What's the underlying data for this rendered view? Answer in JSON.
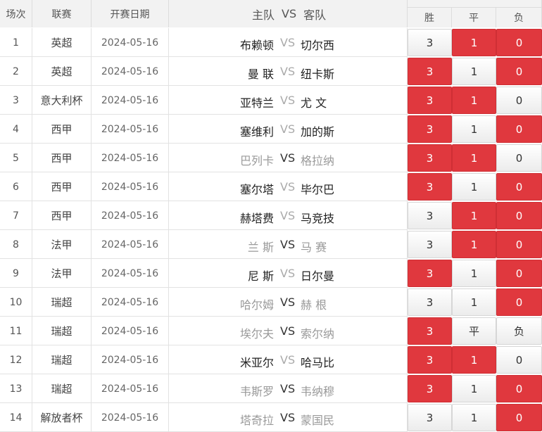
{
  "headers": {
    "index": "场次",
    "league": "联赛",
    "date": "开赛日期",
    "home": "主队",
    "vs": "VS",
    "away": "客队",
    "win": "胜",
    "draw": "平",
    "lose": "负"
  },
  "colors": {
    "selected": "#e0383e",
    "unselected": "#f3f3f3"
  },
  "matches": [
    {
      "no": "1",
      "league": "英超",
      "date": "2024-05-16",
      "home": "布赖顿",
      "away": "切尔西",
      "home_dim": false,
      "away_dim": false,
      "win": "3",
      "draw": "1",
      "lose": "0",
      "sel": [
        false,
        true,
        true
      ]
    },
    {
      "no": "2",
      "league": "英超",
      "date": "2024-05-16",
      "home": "曼 联",
      "away": "纽卡斯",
      "home_dim": false,
      "away_dim": false,
      "win": "3",
      "draw": "1",
      "lose": "0",
      "sel": [
        true,
        false,
        true
      ]
    },
    {
      "no": "3",
      "league": "意大利杯",
      "date": "2024-05-16",
      "home": "亚特兰",
      "away": "尤 文",
      "home_dim": false,
      "away_dim": false,
      "win": "3",
      "draw": "1",
      "lose": "0",
      "sel": [
        true,
        true,
        false
      ]
    },
    {
      "no": "4",
      "league": "西甲",
      "date": "2024-05-16",
      "home": "塞维利",
      "away": "加的斯",
      "home_dim": false,
      "away_dim": false,
      "win": "3",
      "draw": "1",
      "lose": "0",
      "sel": [
        true,
        false,
        true
      ]
    },
    {
      "no": "5",
      "league": "西甲",
      "date": "2024-05-16",
      "home": "巴列卡",
      "away": "格拉纳",
      "home_dim": true,
      "away_dim": true,
      "win": "3",
      "draw": "1",
      "lose": "0",
      "sel": [
        true,
        true,
        false
      ]
    },
    {
      "no": "6",
      "league": "西甲",
      "date": "2024-05-16",
      "home": "塞尔塔",
      "away": "毕尔巴",
      "home_dim": false,
      "away_dim": false,
      "win": "3",
      "draw": "1",
      "lose": "0",
      "sel": [
        true,
        false,
        true
      ]
    },
    {
      "no": "7",
      "league": "西甲",
      "date": "2024-05-16",
      "home": "赫塔费",
      "away": "马竞技",
      "home_dim": false,
      "away_dim": false,
      "win": "3",
      "draw": "1",
      "lose": "0",
      "sel": [
        false,
        true,
        true
      ]
    },
    {
      "no": "8",
      "league": "法甲",
      "date": "2024-05-16",
      "home": "兰 斯",
      "away": "马 赛",
      "home_dim": true,
      "away_dim": true,
      "win": "3",
      "draw": "1",
      "lose": "0",
      "sel": [
        false,
        true,
        true
      ]
    },
    {
      "no": "9",
      "league": "法甲",
      "date": "2024-05-16",
      "home": "尼 斯",
      "away": "日尔曼",
      "home_dim": false,
      "away_dim": false,
      "win": "3",
      "draw": "1",
      "lose": "0",
      "sel": [
        true,
        false,
        true
      ]
    },
    {
      "no": "10",
      "league": "瑞超",
      "date": "2024-05-16",
      "home": "哈尔姆",
      "away": "赫 根",
      "home_dim": true,
      "away_dim": true,
      "win": "3",
      "draw": "1",
      "lose": "0",
      "sel": [
        false,
        false,
        true
      ]
    },
    {
      "no": "11",
      "league": "瑞超",
      "date": "2024-05-16",
      "home": "埃尔夫",
      "away": "索尔纳",
      "home_dim": true,
      "away_dim": true,
      "win": "3",
      "draw": "平",
      "lose": "负",
      "sel": [
        true,
        false,
        false
      ]
    },
    {
      "no": "12",
      "league": "瑞超",
      "date": "2024-05-16",
      "home": "米亚尔",
      "away": "哈马比",
      "home_dim": false,
      "away_dim": false,
      "win": "3",
      "draw": "1",
      "lose": "0",
      "sel": [
        true,
        true,
        false
      ]
    },
    {
      "no": "13",
      "league": "瑞超",
      "date": "2024-05-16",
      "home": "韦斯罗",
      "away": "韦纳穆",
      "home_dim": true,
      "away_dim": true,
      "win": "3",
      "draw": "1",
      "lose": "0",
      "sel": [
        true,
        false,
        true
      ]
    },
    {
      "no": "14",
      "league": "解放者杯",
      "date": "2024-05-16",
      "home": "塔奇拉",
      "away": "蒙国民",
      "home_dim": true,
      "away_dim": true,
      "win": "3",
      "draw": "1",
      "lose": "0",
      "sel": [
        false,
        false,
        true
      ]
    }
  ]
}
